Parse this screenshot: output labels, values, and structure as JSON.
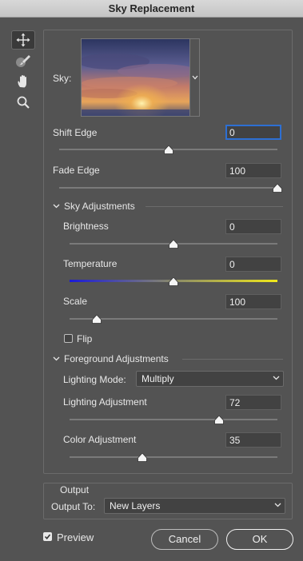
{
  "window": {
    "title": "Sky Replacement"
  },
  "tools": [
    {
      "icon": "move-icon"
    },
    {
      "icon": "sky-brush-icon"
    },
    {
      "icon": "hand-icon"
    },
    {
      "icon": "zoom-icon"
    }
  ],
  "sky": {
    "label": "Sky:"
  },
  "shift_edge": {
    "label": "Shift Edge",
    "value": "0",
    "slider": 0.5
  },
  "fade_edge": {
    "label": "Fade Edge",
    "value": "100",
    "slider": 1.0
  },
  "sky_adjustments": {
    "heading": "Sky Adjustments",
    "brightness": {
      "label": "Brightness",
      "value": "0",
      "slider": 0.5
    },
    "temperature": {
      "label": "Temperature",
      "value": "0",
      "slider": 0.5
    },
    "scale": {
      "label": "Scale",
      "value": "100",
      "slider": 0.13
    },
    "flip": {
      "label": "Flip",
      "checked": false
    }
  },
  "foreground_adjustments": {
    "heading": "Foreground Adjustments",
    "lighting_mode": {
      "label": "Lighting Mode:",
      "value": "Multiply"
    },
    "lighting_adjustment": {
      "label": "Lighting Adjustment",
      "value": "72",
      "slider": 0.72
    },
    "color_adjustment": {
      "label": "Color Adjustment",
      "value": "35",
      "slider": 0.35
    }
  },
  "output": {
    "heading": "Output",
    "label": "Output To:",
    "value": "New Layers"
  },
  "preview": {
    "label": "Preview",
    "checked": true
  },
  "buttons": {
    "cancel": "Cancel",
    "ok": "OK"
  },
  "colors": {
    "accent": "#2d6fd3",
    "background": "#535353",
    "field": "#424242"
  }
}
